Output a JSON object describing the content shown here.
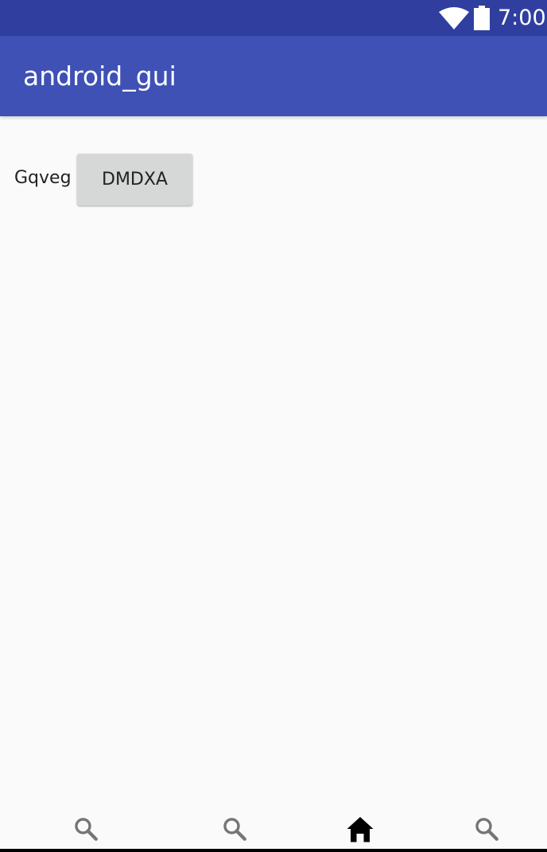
{
  "status_bar": {
    "time": "7:00",
    "wifi_icon": "wifi-icon",
    "battery_icon": "battery-icon",
    "background_color": "#303f9f"
  },
  "app_bar": {
    "title": "android_gui",
    "background_color": "#3f51b5"
  },
  "content": {
    "label": "Gqveg",
    "button_label": "DMDXA"
  },
  "bottom_nav": {
    "items": [
      {
        "icon": "search-icon",
        "active": false
      },
      {
        "icon": "search-icon",
        "active": false
      },
      {
        "icon": "home-icon",
        "active": true
      },
      {
        "icon": "search-icon",
        "active": false
      }
    ],
    "inactive_color": "#757575",
    "active_color": "#000000"
  }
}
